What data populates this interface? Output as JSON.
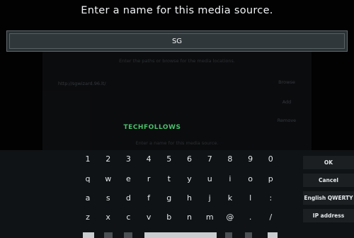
{
  "dialog": {
    "title": "Enter a name for this media source.",
    "input_value": "SG"
  },
  "background": {
    "instruction": "Enter the paths or browse for the media locations.",
    "path": "http://sgwizard.96.lt/",
    "browse_label": "Browse",
    "add_label": "Add",
    "remove_label": "Remove",
    "name_instruction": "Enter a name for this media source."
  },
  "watermark": "TECHFOLLOWS",
  "keyboard": {
    "rows": [
      [
        "1",
        "2",
        "3",
        "4",
        "5",
        "6",
        "7",
        "8",
        "9",
        "0"
      ],
      [
        "q",
        "w",
        "e",
        "r",
        "t",
        "y",
        "u",
        "i",
        "o",
        "p"
      ],
      [
        "a",
        "s",
        "d",
        "f",
        "g",
        "h",
        "j",
        "k",
        "l",
        ":"
      ],
      [
        "z",
        "x",
        "c",
        "v",
        "b",
        "n",
        "m",
        "@",
        ".",
        "/"
      ]
    ],
    "side_buttons": [
      "OK",
      "Cancel",
      "English QWERTY",
      "IP address"
    ]
  },
  "colors": {
    "accent_green": "#49c06a",
    "keyboard_bg": "#101315",
    "input_bg": "#2f373b"
  }
}
